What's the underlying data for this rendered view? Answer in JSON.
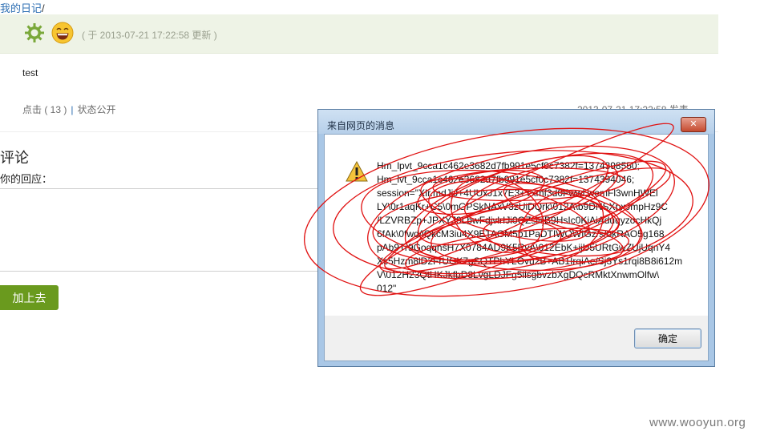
{
  "breadcrumb": {
    "link": "我的日记",
    "sep": "/"
  },
  "post": {
    "update_time": "( 于 2013-07-21 17:22:58 更新 )",
    "body": "test",
    "clicks": "点击 ( 13 )",
    "separator": "|",
    "status": "状态公开",
    "posted": "2013-07-21 17:22:58 发表"
  },
  "comments": {
    "title": "评论",
    "reply_label": "你的回应：",
    "submit": "加上去"
  },
  "dialog": {
    "title": "来自网页的消息",
    "close": "✕",
    "message": "Hm_lpvt_9cca1c462e3682d7fb991e5cf0c7382f=1374398550;\nHm_lvt_9cca1c462e3682d7fb991e5cf0c7382f=1374394046;\nsession=\"XIr.mdJjJ+4UUxJ1x7E3+Txmf3d0Fwwl.wemFl3wnHWEl\nLY\\0r1aqKr+C5\\0mGPSkNAxV3zUiDQrk\\012A\\b9DNSXpxJmpHz9C\n/LZVRBZp+JPXYJ9LbwFdjvlrIJi0QZsiiijB9HsIc0KiAiAduqyzocHkQj\n6fAk\\0fwd/iQkcM3iu4X9ETAOM5b1PaDTIWOWIGz/s/bkRAO5g168\npAb9Tr9GoqqnsH7X0784AD9K5RvA\\012EbK+ijU5URtGwZUjUqnY4\nXc5Hzm8lD2FrUOK7gSQTPhYLOvu2B+AB1IrqiAe/Sj3Ys1rqi8B8i612m\nV\\012H23QtHKJkfbD8LvgLDJFg5ilsgbvzbXgDQcRMktXnwmOlfw\\\n012\"",
    "ok": "确定"
  },
  "watermark": "www.wooyun.org",
  "colors": {
    "accent_green": "#6a9a1e",
    "link_blue": "#2e6fb3",
    "scribble_red": "#e01010"
  }
}
